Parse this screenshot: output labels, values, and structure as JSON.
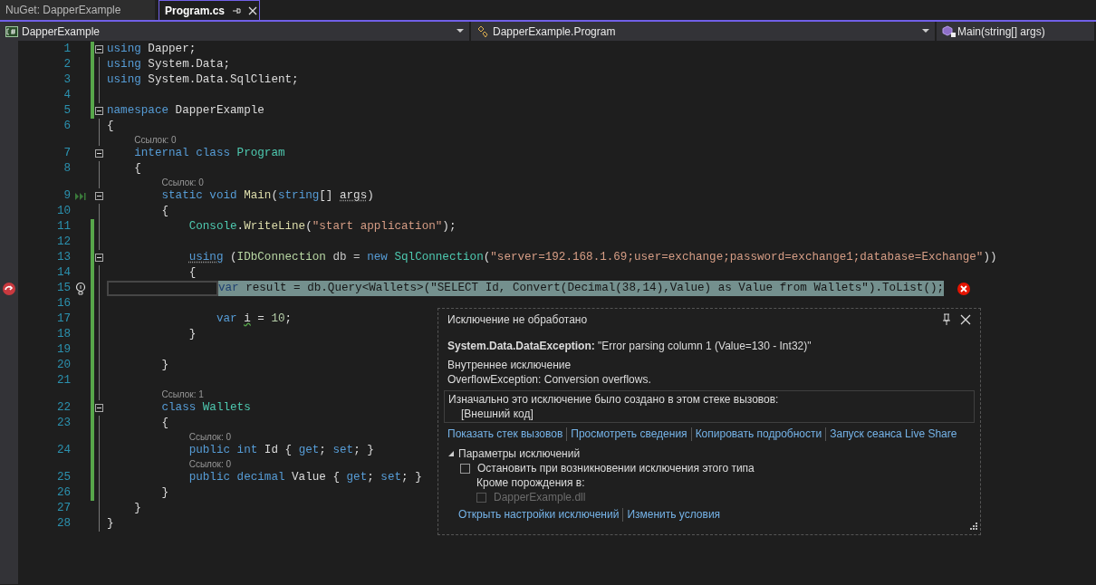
{
  "tabs": [
    {
      "label": "NuGet: DapperExample",
      "selected": false
    },
    {
      "label": "Program.cs",
      "selected": true
    }
  ],
  "nav_bar": {
    "project": "DapperExample",
    "class": "DapperExample.Program",
    "member": "Main(string[] args)"
  },
  "lines": [
    {
      "number": "1",
      "changed": true,
      "fold": true,
      "current": false,
      "tokens": [
        {
          "text": "using",
          "kind": "kw"
        },
        {
          "text": " Dapper;",
          "kind": "p"
        }
      ]
    },
    {
      "number": "2",
      "changed": true,
      "fold": false,
      "current": false,
      "tokens": [
        {
          "text": "using",
          "kind": "kw"
        },
        {
          "text": " System.Data;",
          "kind": "p"
        }
      ]
    },
    {
      "number": "3",
      "changed": true,
      "fold": false,
      "current": false,
      "tokens": [
        {
          "text": "using",
          "kind": "kw"
        },
        {
          "text": " System.Data.SqlClient;",
          "kind": "p"
        }
      ]
    },
    {
      "number": "4",
      "changed": true,
      "fold": false,
      "current": false
    },
    {
      "number": "5",
      "changed": true,
      "fold": true,
      "current": false,
      "tokens": [
        {
          "text": "namespace",
          "kind": "kw"
        },
        {
          "text": " DapperExample",
          "kind": "p"
        }
      ]
    },
    {
      "number": "6",
      "changed": false,
      "fold": false,
      "current": false,
      "tokens": [
        {
          "text": "{",
          "kind": "p"
        }
      ],
      "children": [
        {
          "number": "7",
          "changed": false,
          "fold": true,
          "current": false,
          "codelens": "Ссылок: 0",
          "tokens": [
            {
              "text": "internal class ",
              "kind": "kw"
            },
            {
              "text": "Program",
              "kind": "type"
            }
          ]
        },
        {
          "number": "8",
          "changed": false,
          "fold": false,
          "current": false,
          "tokens": [
            {
              "text": "{",
              "kind": "p"
            }
          ],
          "children": [
            {
              "number": "9",
              "changed": false,
              "fold": true,
              "current": false,
              "run_marker": true,
              "codelens": "Ссылок: 0",
              "tokens": [
                {
                  "text": "static void ",
                  "kind": "kw"
                },
                {
                  "text": "Main",
                  "kind": "method"
                },
                {
                  "text": "(",
                  "kind": "p"
                },
                {
                  "text": "string",
                  "kind": "kw"
                },
                {
                  "text": "[] ",
                  "kind": "p"
                },
                {
                  "text": "args",
                  "kind": "p",
                  "dotted": true
                },
                {
                  "text": ")",
                  "kind": "p"
                }
              ]
            },
            {
              "number": "10",
              "changed": false,
              "fold": false,
              "current": false,
              "tokens": [
                {
                  "text": "{",
                  "kind": "p"
                }
              ],
              "children": [
                {
                  "number": "11",
                  "changed": true,
                  "fold": false,
                  "current": false,
                  "tokens": [
                    {
                      "text": "Console",
                      "kind": "type"
                    },
                    {
                      "text": ".",
                      "kind": "p"
                    },
                    {
                      "text": "WriteLine",
                      "kind": "method"
                    },
                    {
                      "text": "(",
                      "kind": "p"
                    },
                    {
                      "text": "\"start application\"",
                      "kind": "str"
                    },
                    {
                      "text": ");",
                      "kind": "p"
                    }
                  ]
                },
                {
                  "number": "12",
                  "changed": true,
                  "fold": false,
                  "current": false
                },
                {
                  "number": "13",
                  "changed": true,
                  "fold": true,
                  "current": false,
                  "tokens": [
                    {
                      "text": "using",
                      "kind": "kw",
                      "dotted": true
                    },
                    {
                      "text": " (",
                      "kind": "p"
                    },
                    {
                      "text": "IDbConnection",
                      "kind": "iface"
                    },
                    {
                      "text": " db = ",
                      "kind": "var"
                    },
                    {
                      "text": "new ",
                      "kind": "kw"
                    },
                    {
                      "text": "SqlConnection",
                      "kind": "type"
                    },
                    {
                      "text": "(",
                      "kind": "p"
                    },
                    {
                      "text": "\"server=192.168.1.69;user=exchange;password=exchange1;database=Exchange\"",
                      "kind": "str"
                    },
                    {
                      "text": "))",
                      "kind": "p"
                    }
                  ]
                },
                {
                  "number": "14",
                  "changed": true,
                  "fold": false,
                  "current": false,
                  "tokens": [
                    {
                      "text": "{",
                      "kind": "p"
                    }
                  ],
                  "children": [
                    {
                      "number": "15",
                      "changed": true,
                      "fold": false,
                      "current": true,
                      "exception_marker": true,
                      "lightbulb": true,
                      "error": true,
                      "tokens": [
                        {
                          "text": "var",
                          "kind": "kw"
                        },
                        {
                          "text": " result = db.",
                          "kind": "p"
                        },
                        {
                          "text": "Query",
                          "kind": "method"
                        },
                        {
                          "text": "<",
                          "kind": "p"
                        },
                        {
                          "text": "Wallets",
                          "kind": "type"
                        },
                        {
                          "text": ">(",
                          "kind": "p"
                        },
                        {
                          "text": "\"SELECT Id, Convert(Decimal(38,14),Value) as Value from Wallets\"",
                          "kind": "str"
                        },
                        {
                          "text": ").",
                          "kind": "p"
                        },
                        {
                          "text": "ToList",
                          "kind": "method"
                        },
                        {
                          "text": "();",
                          "kind": "p"
                        }
                      ]
                    },
                    {
                      "number": "16",
                      "changed": true,
                      "fold": false,
                      "current": false
                    },
                    {
                      "number": "17",
                      "changed": true,
                      "fold": false,
                      "current": false,
                      "tokens": [
                        {
                          "text": "var ",
                          "kind": "kw"
                        },
                        {
                          "text": "i",
                          "kind": "p",
                          "squiggle": true
                        },
                        {
                          "text": " = ",
                          "kind": "p"
                        },
                        {
                          "text": "10",
                          "kind": "num"
                        },
                        {
                          "text": ";",
                          "kind": "p"
                        }
                      ]
                    }
                  ]
                },
                {
                  "number": "18",
                  "changed": true,
                  "fold": false,
                  "current": false,
                  "tokens": [
                    {
                      "text": "}",
                      "kind": "p"
                    }
                  ]
                },
                {
                  "number": "19",
                  "changed": true,
                  "fold": false,
                  "current": false
                }
              ]
            },
            {
              "number": "20",
              "changed": true,
              "fold": false,
              "current": false,
              "tokens": [
                {
                  "text": "}",
                  "kind": "p"
                }
              ]
            },
            {
              "number": "21",
              "changed": true,
              "fold": false,
              "current": false
            },
            {
              "number": "22",
              "changed": true,
              "fold": true,
              "current": false,
              "codelens": "Ссылок: 1",
              "tokens": [
                {
                  "text": "class ",
                  "kind": "kw"
                },
                {
                  "text": "Wallets",
                  "kind": "type"
                }
              ]
            },
            {
              "number": "23",
              "changed": true,
              "fold": false,
              "current": false,
              "tokens": [
                {
                  "text": "{",
                  "kind": "p"
                }
              ],
              "children": [
                {
                  "number": "24",
                  "changed": true,
                  "fold": false,
                  "current": false,
                  "codelens": "Ссылок: 0",
                  "tokens": [
                    {
                      "text": "public int",
                      "kind": "kw"
                    },
                    {
                      "text": " Id { ",
                      "kind": "p"
                    },
                    {
                      "text": "get",
                      "kind": "kw"
                    },
                    {
                      "text": "; ",
                      "kind": "p"
                    },
                    {
                      "text": "set",
                      "kind": "kw"
                    },
                    {
                      "text": "; }",
                      "kind": "p"
                    }
                  ]
                },
                {
                  "number": "25",
                  "changed": true,
                  "fold": false,
                  "current": false,
                  "codelens": "Ссылок: 0",
                  "tokens": [
                    {
                      "text": "public decimal",
                      "kind": "kw"
                    },
                    {
                      "text": " Value { ",
                      "kind": "p"
                    },
                    {
                      "text": "get",
                      "kind": "kw"
                    },
                    {
                      "text": "; ",
                      "kind": "p"
                    },
                    {
                      "text": "set",
                      "kind": "kw"
                    },
                    {
                      "text": "; }",
                      "kind": "p"
                    }
                  ]
                }
              ]
            },
            {
              "number": "26",
              "changed": true,
              "fold": false,
              "current": false,
              "tokens": [
                {
                  "text": "}",
                  "kind": "p"
                }
              ]
            }
          ]
        },
        {
          "number": "27",
          "changed": false,
          "fold": false,
          "current": false,
          "tokens": [
            {
              "text": "}",
              "kind": "p"
            }
          ]
        }
      ]
    },
    {
      "number": "28",
      "changed": false,
      "fold": false,
      "current": false,
      "tokens": [
        {
          "text": "}",
          "kind": "p"
        }
      ]
    }
  ],
  "exception_popup": {
    "title": "Исключение не обработано",
    "exception": "**System.Data.DataException:** \"Error parsing column 1 (Value=130 - Int32)\"",
    "inner_heading": "Внутреннее исключение",
    "inner_message": "OverflowException: Conversion overflows.",
    "stack_heading": "Изначально это исключение было создано в этом стеке вызовов:",
    "stack_frames": [
      "[Внешний код]"
    ],
    "links": [
      "Показать стек вызовов",
      "Просмотреть сведения",
      "Копировать подробности",
      "Запуск сеанса Live Share"
    ],
    "settings": {
      "heading": "Параметры исключений",
      "expanded": true,
      "break_option": {
        "label": "Остановить при возникновении исключения этого типа",
        "checked": false
      },
      "except_heading": "Кроме порождения в:",
      "modules": [
        {
          "label": "DapperExample.dll",
          "checked": false,
          "disabled": true
        }
      ]
    },
    "footer_links": [
      "Открыть настройки исключений",
      "Изменить условия"
    ]
  }
}
